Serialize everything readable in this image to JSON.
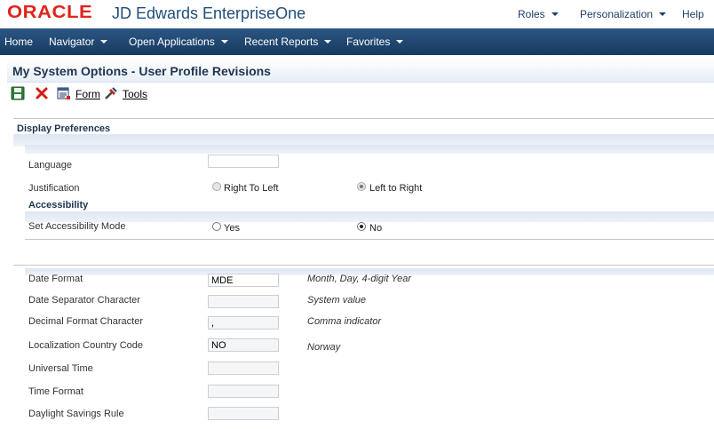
{
  "header": {
    "brand": "ORACLE",
    "product": "JD Edwards EnterpriseOne",
    "menus": [
      "Roles",
      "Personalization",
      "Help"
    ]
  },
  "nav": {
    "items": [
      "Home",
      "Navigator",
      "Open Applications",
      "Recent Reports",
      "Favorites"
    ]
  },
  "page": {
    "title": "My System Options - User Profile Revisions"
  },
  "toolbar": {
    "form_label": "Form",
    "tools_label": "Tools"
  },
  "display_preferences": {
    "title": "Display Preferences",
    "language_label": "Language",
    "language_value": "",
    "justification_label": "Justification",
    "justification_options": [
      "Right To Left",
      "Left to Right"
    ],
    "justification_selected": "Left to Right"
  },
  "accessibility": {
    "title": "Accessibility",
    "mode_label": "Set Accessibility Mode",
    "mode_options": [
      "Yes",
      "No"
    ],
    "mode_selected": "No"
  },
  "formats": {
    "date_format": {
      "label": "Date Format",
      "value": "MDE",
      "desc": "Month, Day, 4-digit Year"
    },
    "date_separator": {
      "label": "Date Separator Character",
      "value": "",
      "desc": "System value"
    },
    "decimal_format": {
      "label": "Decimal Format Character",
      "value": ",",
      "desc": "Comma indicator"
    },
    "country_code": {
      "label": "Localization Country Code",
      "value": "NO",
      "desc": "Norway"
    },
    "universal_time": {
      "label": "Universal Time",
      "value": ""
    },
    "time_format": {
      "label": "Time Format",
      "value": ""
    },
    "daylight_rule": {
      "label": "Daylight Savings Rule",
      "value": ""
    }
  },
  "colors": {
    "oracle_red": "#e2231a",
    "nav_blue": "#183a5e",
    "title_text": "#1f3550"
  }
}
